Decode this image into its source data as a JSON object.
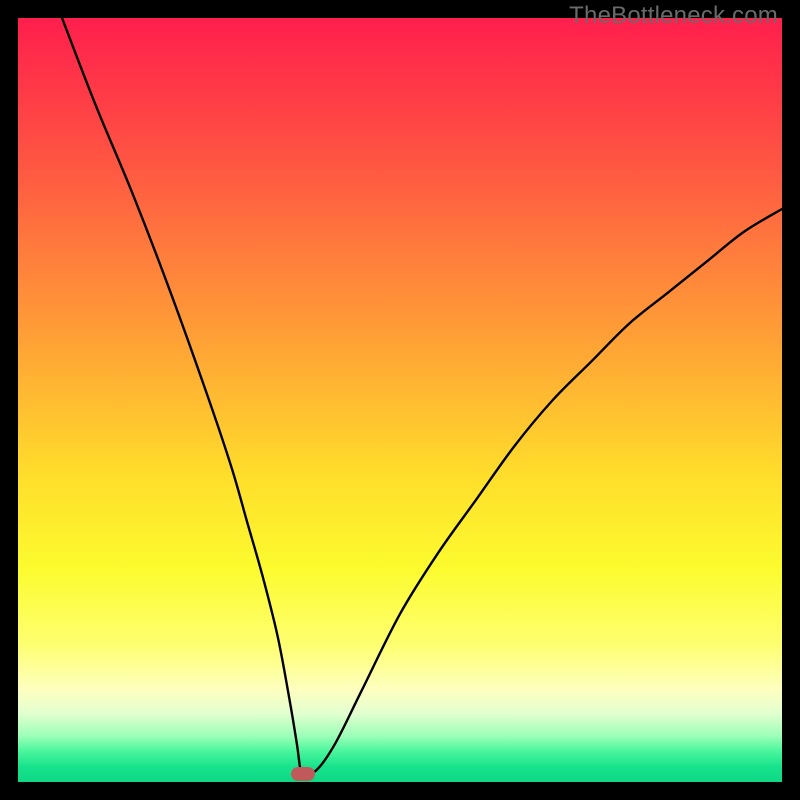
{
  "watermark": "TheBottleneck.com",
  "colors": {
    "frame": "#000000",
    "gradient_top": "#ff1f4d",
    "gradient_bottom": "#0fd885",
    "curve": "#000000",
    "marker": "#c05a5a",
    "watermark_text": "#6a6a6a"
  },
  "chart_data": {
    "type": "line",
    "title": "",
    "xlabel": "",
    "ylabel": "",
    "xlim": [
      0,
      100
    ],
    "ylim": [
      0,
      100
    ],
    "grid": false,
    "series": [
      {
        "name": "bottleneck-curve",
        "x": [
          0,
          5,
          10,
          15,
          20,
          25,
          28,
          30,
          32,
          34,
          35.5,
          36.5,
          37,
          37.5,
          39,
          41.5,
          45,
          50,
          55,
          60,
          65,
          70,
          75,
          80,
          85,
          90,
          95,
          100
        ],
        "y": [
          115,
          102,
          89,
          77,
          64,
          50,
          41,
          34,
          27,
          19,
          11,
          5,
          1.5,
          1.5,
          1.5,
          5,
          12,
          22,
          30,
          37,
          44,
          50,
          55,
          60,
          64,
          68,
          72,
          75
        ]
      }
    ],
    "marker": {
      "x": 37.3,
      "y": 1.0
    },
    "notes": "V-shaped bottleneck curve over vertical heat gradient (red=high bottleneck at top, green=optimal at bottom). Minimum (optimal point) highlighted by rounded marker near x≈37."
  }
}
